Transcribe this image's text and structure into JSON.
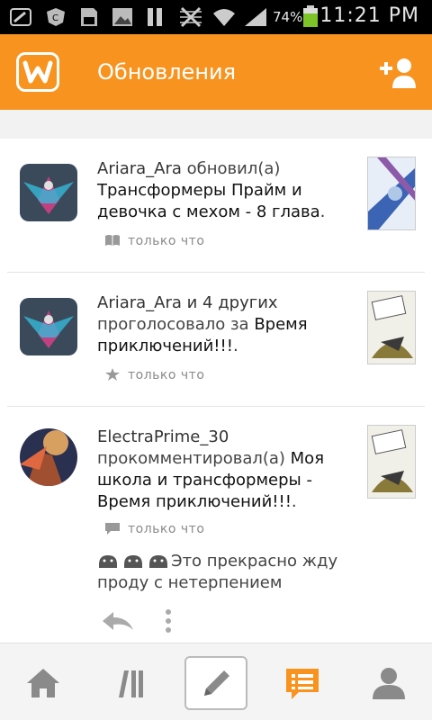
{
  "status_bar": {
    "battery_percent": "74%",
    "time": "11:21 PM"
  },
  "app_bar": {
    "title": "Обновления",
    "logo_icon": "wattpad-logo-icon",
    "action_icon": "add-user-icon"
  },
  "feed": {
    "items": [
      {
        "user": "Ariara_Ara",
        "action": " обновил(а) ",
        "story": "Трансформеры Прайм и девочка с мехом - 8 глава",
        "story_suffix": ".",
        "meta_icon": "book-icon",
        "timestamp": "только что"
      },
      {
        "user": "Ariara_Ara и 4 других",
        "action": "проголосовало за ",
        "story": "Время приключений!!!",
        "story_suffix": ".",
        "meta_icon": "star-icon",
        "timestamp": "только что"
      },
      {
        "user": "ElectraPrime_30",
        "action": "прокомментировал(а) ",
        "story": "Моя школа и трансформеры - Время приключений!!!",
        "story_suffix": ".",
        "meta_icon": "comment-icon",
        "timestamp": "только что",
        "comment": "Это прекрасно   жду проду с нетерпением"
      }
    ]
  },
  "bottom_nav": {
    "items": [
      "home-icon",
      "library-icon",
      "write-icon",
      "updates-icon",
      "profile-icon"
    ],
    "active": "updates-icon"
  },
  "colors": {
    "accent": "#f7931e",
    "icon_grey": "#8a8a8a"
  }
}
